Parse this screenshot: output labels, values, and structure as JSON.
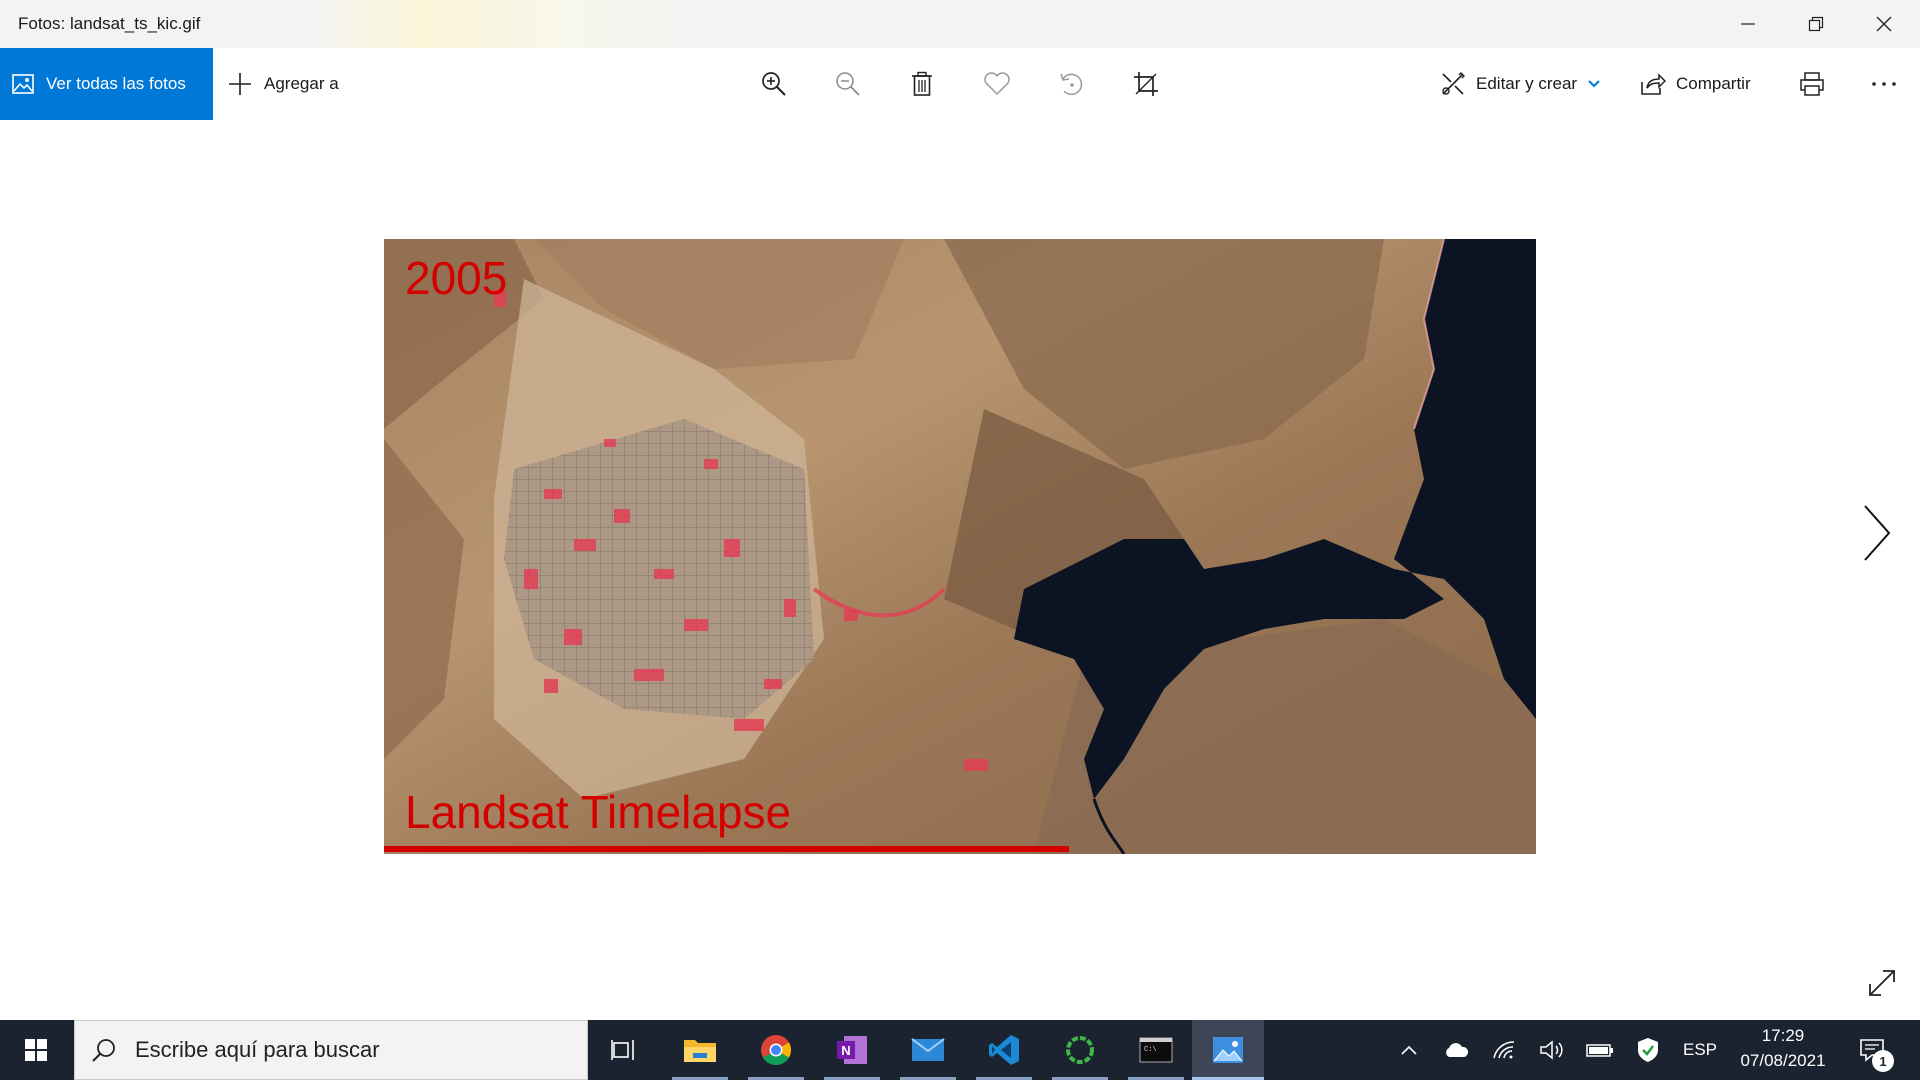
{
  "window": {
    "title": "Fotos: landsat_ts_kic.gif",
    "controls": [
      "minimize-icon",
      "restore-icon",
      "close-icon"
    ]
  },
  "toolbar": {
    "all_photos_label": "Ver todas las fotos",
    "add_to_label": "Agregar a",
    "tools": [
      "zoom-in-icon",
      "zoom-out-icon",
      "delete-icon",
      "favorite-icon",
      "rotate-icon",
      "crop-icon"
    ],
    "edit_create_label": "Editar y crear",
    "share_label": "Compartir",
    "print_icon": "print-icon",
    "more_icon": "more-icon"
  },
  "photo": {
    "year_label": "2005",
    "brand_label": "Landsat Timelapse",
    "timeline_progress_percent": 59.5
  },
  "taskbar": {
    "search_placeholder": "Escribe aquí para buscar",
    "apps": [
      "task-view-icon",
      "file-explorer-icon",
      "chrome-icon",
      "onenote-icon",
      "mail-icon",
      "vscode-icon",
      "green-circle-app-icon",
      "terminal-icon",
      "photos-icon"
    ],
    "language": "ESP",
    "time": "17:29",
    "date": "07/08/2021",
    "notification_count": "1"
  },
  "colors": {
    "accent": "#0078d7",
    "taskbar_bg": "#1b2230",
    "timelapse_red": "#d40000",
    "lake": "#0c1424"
  }
}
